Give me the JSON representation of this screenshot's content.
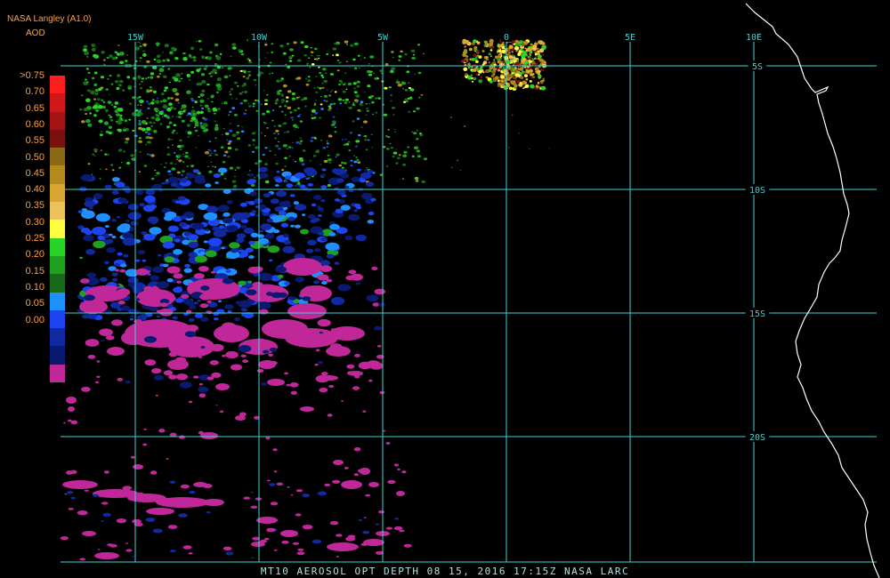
{
  "header": {
    "title": "NASA Langley (A1.0)",
    "unit": "AOD"
  },
  "colors": {
    "grid": "#3fd3d3",
    "label_orange": "#ff9f40",
    "coast": "#ffffff",
    "footer": "#b4e0e0"
  },
  "legend": {
    "labels": [
      ">0.75",
      "0.70",
      "0.65",
      "0.60",
      "0.55",
      "0.50",
      "0.45",
      "0.40",
      "0.35",
      "0.30",
      "0.25",
      "0.20",
      "0.15",
      "0.10",
      "0.05",
      "0.00"
    ],
    "colors": [
      "#ff1e1e",
      "#d01818",
      "#a51414",
      "#7a1010",
      "#8a6a14",
      "#b38a1e",
      "#d9a732",
      "#ebc15a",
      "#ffff40",
      "#28d428",
      "#20a020",
      "#186a18",
      "#1e90ff",
      "#1c44f0",
      "#1228a0",
      "#0a1a70",
      "#c0289a"
    ]
  },
  "axes": {
    "lon_labels": [
      "15W",
      "10W",
      "5W",
      "0",
      "5E",
      "10E"
    ],
    "lat_labels": [
      "5S",
      "10S",
      "15S",
      "20S"
    ]
  },
  "footer": {
    "text": "MT10  AEROSOL OPT DEPTH   08 15, 2016 17:15Z   NASA LARC"
  }
}
